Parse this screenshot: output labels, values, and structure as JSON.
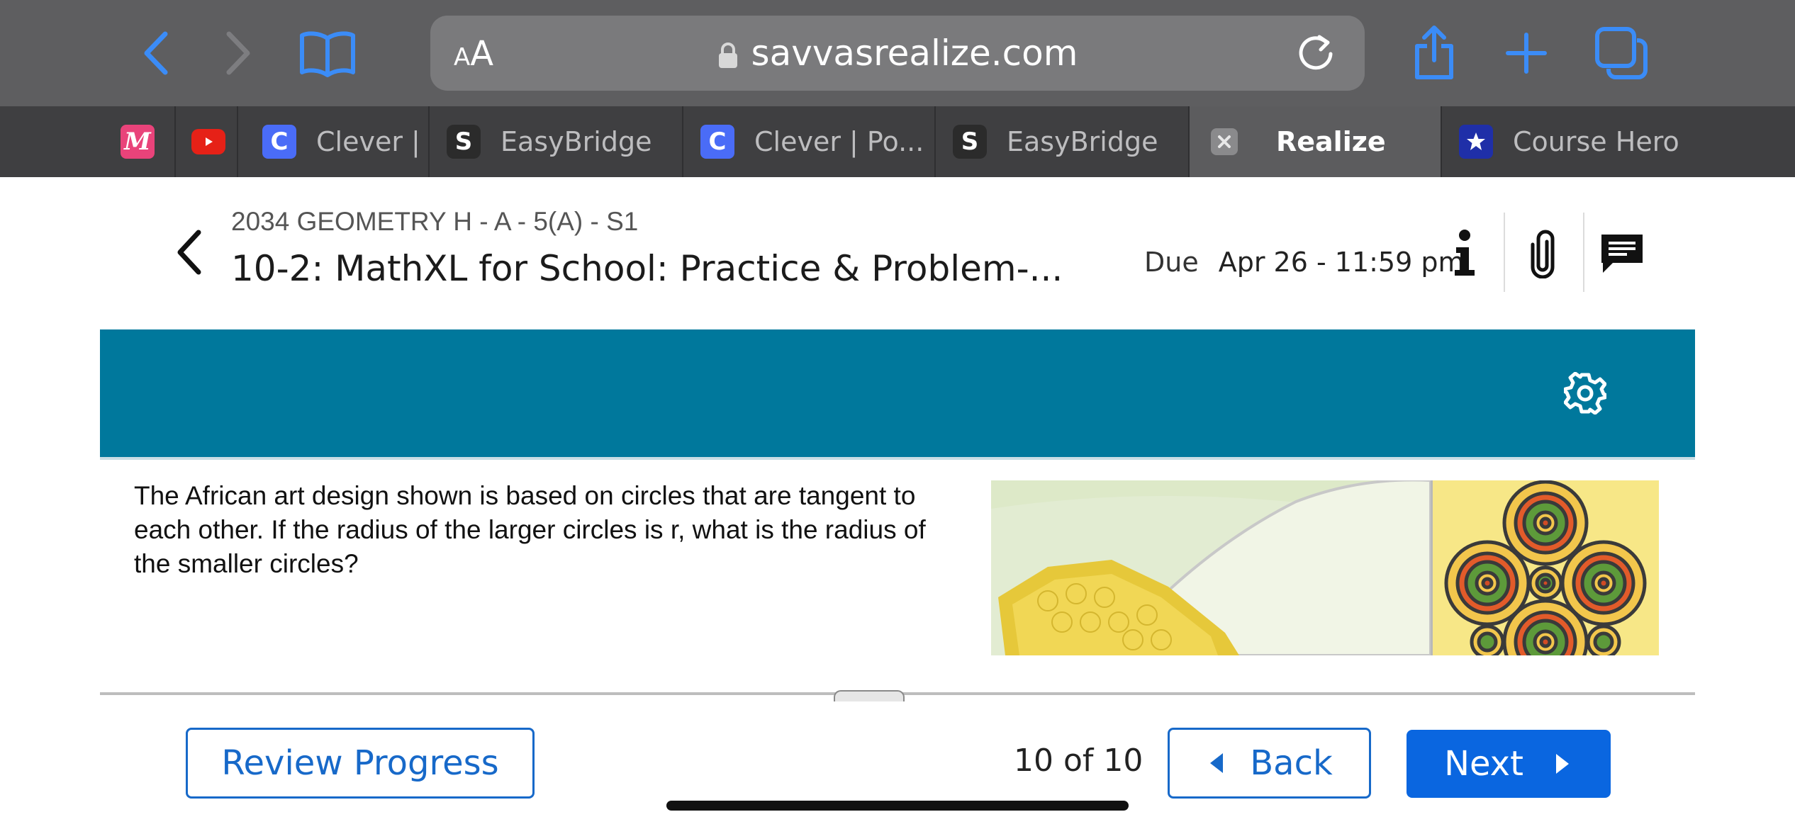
{
  "browser": {
    "url_host": "savvasrealize.com",
    "aa_label_small": "A",
    "aa_label_large": "A",
    "tabs": [
      {
        "label": "",
        "icon": "mathxl-favicon"
      },
      {
        "label": "",
        "icon": "youtube-favicon"
      },
      {
        "label": "Clever | P",
        "icon": "clever-favicon"
      },
      {
        "label": "EasyBridge",
        "icon": "easybridge-favicon"
      },
      {
        "label": "Clever | Po...",
        "icon": "clever-favicon"
      },
      {
        "label": "EasyBridge",
        "icon": "easybridge-favicon"
      },
      {
        "label": "Realize",
        "icon": "close-icon",
        "active": true
      },
      {
        "label": "Course Hero",
        "icon": "coursehero-favicon"
      }
    ],
    "favicon_letters": {
      "clever": "C",
      "easybridge": "S"
    },
    "colors": {
      "accent": "#3b8cf7"
    }
  },
  "assignment": {
    "course": "2034 GEOMETRY H - A - 5(A) - S1",
    "title": "10-2: MathXL for School: Practice & Problem-...",
    "due_label": "Due",
    "due_date": "Apr 26 - 11:59 pm"
  },
  "banner": {
    "color": "#00789c"
  },
  "question": {
    "text": "The African art design shown is based on circles that are tangent to each other. If the radius of the larger circles is r, what is the radius of the smaller circles?"
  },
  "footer": {
    "review_progress_label": "Review Progress",
    "counter": "10 of 10",
    "back_label": "Back",
    "next_label": "Next",
    "colors": {
      "primary": "#0a66e0"
    }
  }
}
